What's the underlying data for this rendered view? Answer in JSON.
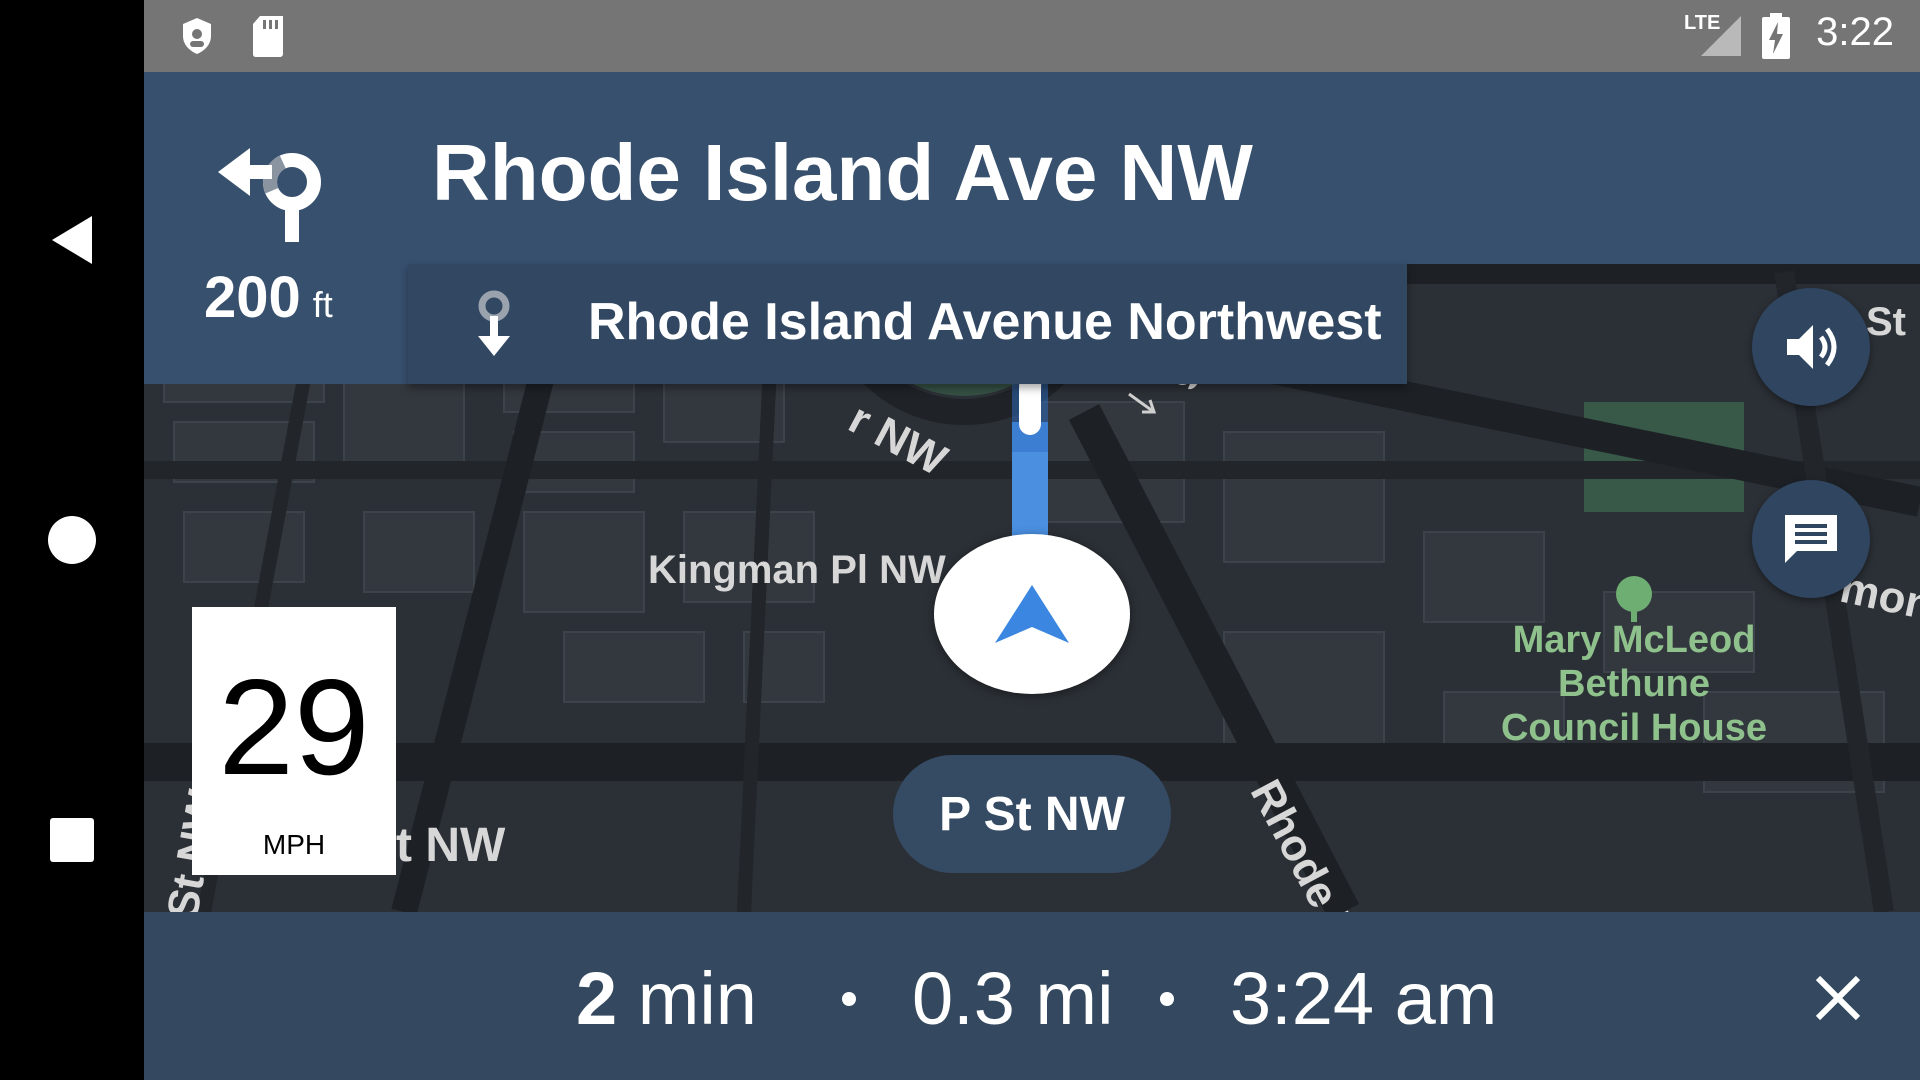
{
  "status_bar": {
    "time": "3:22",
    "network_label": "LTE",
    "icons": [
      "shield-icon",
      "sd-card-icon",
      "signal-icon",
      "battery-charging-icon"
    ]
  },
  "nav_bar": {
    "icons": [
      "back-icon",
      "home-icon",
      "recents-icon"
    ]
  },
  "instruction": {
    "street": "Rhode Island Ave NW",
    "distance_value": "200",
    "distance_unit": "ft",
    "maneuver_icon": "roundabout-left-icon",
    "next_street": "Rhode Island Avenue Northwest",
    "next_icon": "destination-arrow-icon"
  },
  "map": {
    "labels": {
      "kingman": "Kingman Pl NW",
      "rhode_island_diag": "Rhode Island Av",
      "poi": "Mary McLeod Bethune Council House",
      "circle_nw": "r NW",
      "circle_top": "gal",
      "st_top_right": "St",
      "mon": "mon",
      "st_nw_bottom": "t NW",
      "st_nw_vertical": "St NW",
      "s_bottom": "S"
    },
    "current_street": "P St NW",
    "colors": {
      "map_bg": "#2b3036",
      "route_blue": "#4a8fe0",
      "park_green": "#3e6b50",
      "poi_text": "#8fc18c"
    }
  },
  "speed": {
    "value": "29",
    "unit": "MPH"
  },
  "fabs": {
    "sound": "volume-icon",
    "message": "message-icon"
  },
  "trip": {
    "time_value": "2",
    "time_unit": "min",
    "distance": "0.3 mi",
    "eta": "3:24 am",
    "close_icon": "close-icon"
  }
}
